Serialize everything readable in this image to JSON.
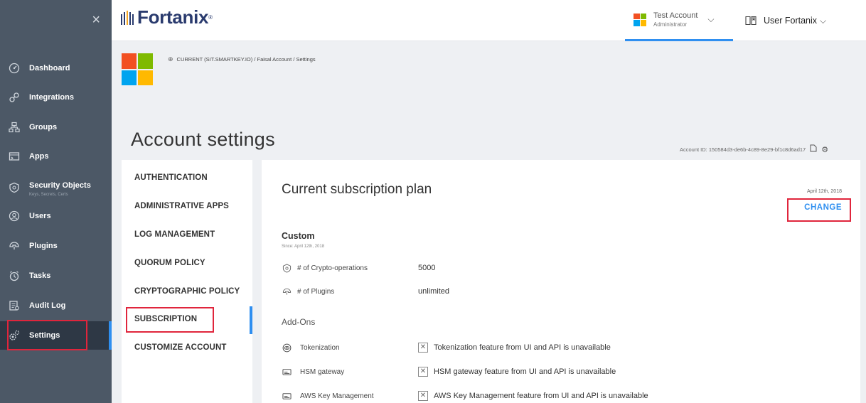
{
  "sidebar": {
    "close_label": "×",
    "items": [
      {
        "label": "Dashboard",
        "icon": "dashboard-icon",
        "sub": ""
      },
      {
        "label": "Integrations",
        "icon": "integrations-icon",
        "sub": ""
      },
      {
        "label": "Groups",
        "icon": "groups-icon",
        "sub": ""
      },
      {
        "label": "Apps",
        "icon": "apps-icon",
        "sub": ""
      },
      {
        "label": "Security Objects",
        "icon": "security-objects-icon",
        "sub": "Keys, Secrets, Certs"
      },
      {
        "label": "Users",
        "icon": "users-icon",
        "sub": ""
      },
      {
        "label": "Plugins",
        "icon": "plugins-icon",
        "sub": ""
      },
      {
        "label": "Tasks",
        "icon": "tasks-icon",
        "sub": ""
      },
      {
        "label": "Audit Log",
        "icon": "audit-log-icon",
        "sub": ""
      },
      {
        "label": "Settings",
        "icon": "settings-icon",
        "sub": "",
        "active": true
      }
    ]
  },
  "header": {
    "brand": "Fortanix",
    "brand_reg": "®",
    "account_name": "Test Account",
    "account_role": "Administrator",
    "user_name": "User Fortanix",
    "chevron": "⌵"
  },
  "breadcrumb": "CURRENT (SIT.SMARTKEY.IO)  / Faisal Account / Settings",
  "page_title": "Account settings",
  "account_id": "Account ID: 150584d3-de6b-4c89-8e29-bf1c8d6ad17",
  "settings_menu": [
    "AUTHENTICATION",
    "ADMINISTRATIVE APPS",
    "LOG MANAGEMENT",
    "QUORUM POLICY",
    "CRYPTOGRAPHIC POLICY",
    "SUBSCRIPTION",
    "CUSTOMIZE ACCOUNT"
  ],
  "subscription": {
    "title": "Current subscription plan",
    "date": "April 12th, 2018",
    "change_label": "CHANGE",
    "plan_name": "Custom",
    "plan_since": "Since: April 12th, 2018",
    "crypto_ops_label": "# of Crypto-operations",
    "crypto_ops_value": "5000",
    "plugins_label": "# of Plugins",
    "plugins_value": "unlimited",
    "addons_label": "Add-Ons",
    "addons": [
      {
        "name": "Tokenization",
        "icon": "tokenization-icon",
        "status": "Tokenization feature from UI and API is unavailable"
      },
      {
        "name": "HSM gateway",
        "icon": "hsm-gateway-icon",
        "status": "HSM gateway feature from UI and API is unavailable"
      },
      {
        "name": "AWS Key Management",
        "icon": "aws-key-management-icon",
        "status": "AWS Key Management feature from UI and API is unavailable"
      }
    ]
  },
  "colors": {
    "sidebar_bg": "#4c5866",
    "sidebar_active_bg": "#2e3845",
    "accent_blue": "#2f8ff0",
    "highlight_red": "#e0253c",
    "brand_navy": "#2a3b6e",
    "ms_red": "#f25022",
    "ms_green": "#7fba00",
    "ms_blue": "#00a4ef",
    "ms_yellow": "#ffb900"
  }
}
